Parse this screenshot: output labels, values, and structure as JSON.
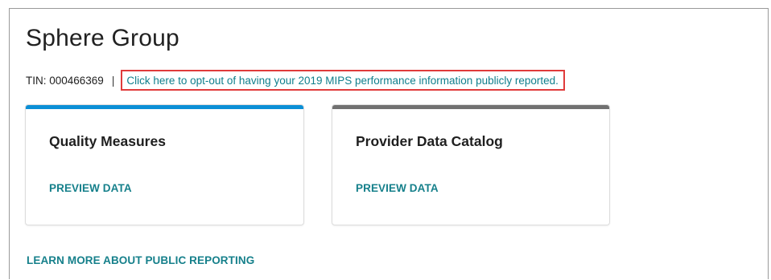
{
  "header": {
    "title": "Sphere Group",
    "tin_label": "TIN: 000466369",
    "separator": "|",
    "optout_link": "Click here to opt-out of having your 2019 MIPS performance information publicly reported."
  },
  "cards": [
    {
      "title": "Quality Measures",
      "link": "PREVIEW DATA",
      "accent_color": "#0b8fd6"
    },
    {
      "title": "Provider Data Catalog",
      "link": "PREVIEW DATA",
      "accent_color": "#717171"
    }
  ],
  "footer": {
    "learn_more": "LEARN MORE ABOUT PUBLIC REPORTING"
  },
  "colors": {
    "link": "#16808b",
    "highlight_border": "#e03b3b"
  }
}
